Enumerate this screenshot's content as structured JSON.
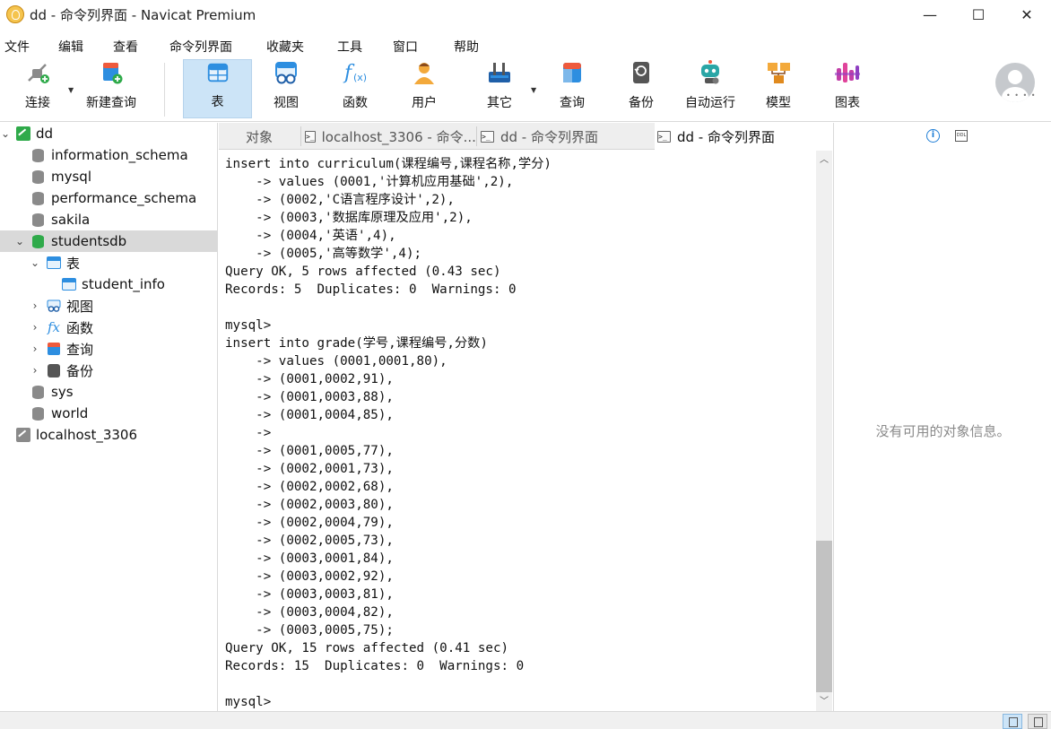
{
  "window": {
    "title": "dd - 命令列界面 - Navicat Premium",
    "minimize": "—",
    "maximize": "☐",
    "close": "✕"
  },
  "menu": [
    "文件",
    "编辑",
    "查看",
    "命令列界面",
    "收藏夹",
    "工具",
    "窗口",
    "帮助"
  ],
  "toolbar": [
    {
      "label": "连接",
      "icon": "plug-connect-icon"
    },
    {
      "label": "新建查询",
      "icon": "new-query-icon"
    },
    {
      "label": "表",
      "icon": "table-icon"
    },
    {
      "label": "视图",
      "icon": "view-icon"
    },
    {
      "label": "函数",
      "icon": "function-icon"
    },
    {
      "label": "用户",
      "icon": "user-icon"
    },
    {
      "label": "其它",
      "icon": "tools-icon"
    },
    {
      "label": "查询",
      "icon": "query-icon"
    },
    {
      "label": "备份",
      "icon": "backup-icon"
    },
    {
      "label": "自动运行",
      "icon": "robot-icon"
    },
    {
      "label": "模型",
      "icon": "model-icon"
    },
    {
      "label": "图表",
      "icon": "chart-icon"
    }
  ],
  "tree": {
    "connection": "dd",
    "databases": [
      "information_schema",
      "mysql",
      "performance_schema",
      "sakila"
    ],
    "selected_db": "studentsdb",
    "groups": {
      "tables": "表",
      "table_items": [
        "student_info"
      ],
      "views": "视图",
      "functions": "函数",
      "queries": "查询",
      "backups": "备份"
    },
    "more_dbs": [
      "sys",
      "world"
    ],
    "other_connection": "localhost_3306"
  },
  "tabs": [
    {
      "label": "对象"
    },
    {
      "label": "localhost_3306 - 命令..."
    },
    {
      "label": "dd - 命令列界面"
    },
    {
      "label": "dd - 命令列界面"
    }
  ],
  "terminal_lines": [
    "insert into curriculum(课程编号,课程名称,学分)",
    "    -> values (0001,'计算机应用基础',2),",
    "    -> (0002,'C语言程序设计',2),",
    "    -> (0003,'数据库原理及应用',2),",
    "    -> (0004,'英语',4),",
    "    -> (0005,'高等数学',4);",
    "Query OK, 5 rows affected (0.43 sec)",
    "Records: 5  Duplicates: 0  Warnings: 0",
    "",
    "mysql>",
    "insert into grade(学号,课程编号,分数)",
    "    -> values (0001,0001,80),",
    "    -> (0001,0002,91),",
    "    -> (0001,0003,88),",
    "    -> (0001,0004,85),",
    "    ->",
    "    -> (0001,0005,77),",
    "    -> (0002,0001,73),",
    "    -> (0002,0002,68),",
    "    -> (0002,0003,80),",
    "    -> (0002,0004,79),",
    "    -> (0002,0005,73),",
    "    -> (0003,0001,84),",
    "    -> (0003,0002,92),",
    "    -> (0003,0003,81),",
    "    -> (0003,0004,82),",
    "    -> (0003,0005,75);",
    "Query OK, 15 rows affected (0.41 sec)",
    "Records: 15  Duplicates: 0  Warnings: 0",
    "",
    "mysql>"
  ],
  "right_panel": {
    "empty_text": "没有可用的对象信息。",
    "ddl_label": "DDL"
  },
  "colors": {
    "accent": "#2d8ee0",
    "selected_tab_bg": "#cce4f7",
    "db_active": "#2faa4a"
  }
}
